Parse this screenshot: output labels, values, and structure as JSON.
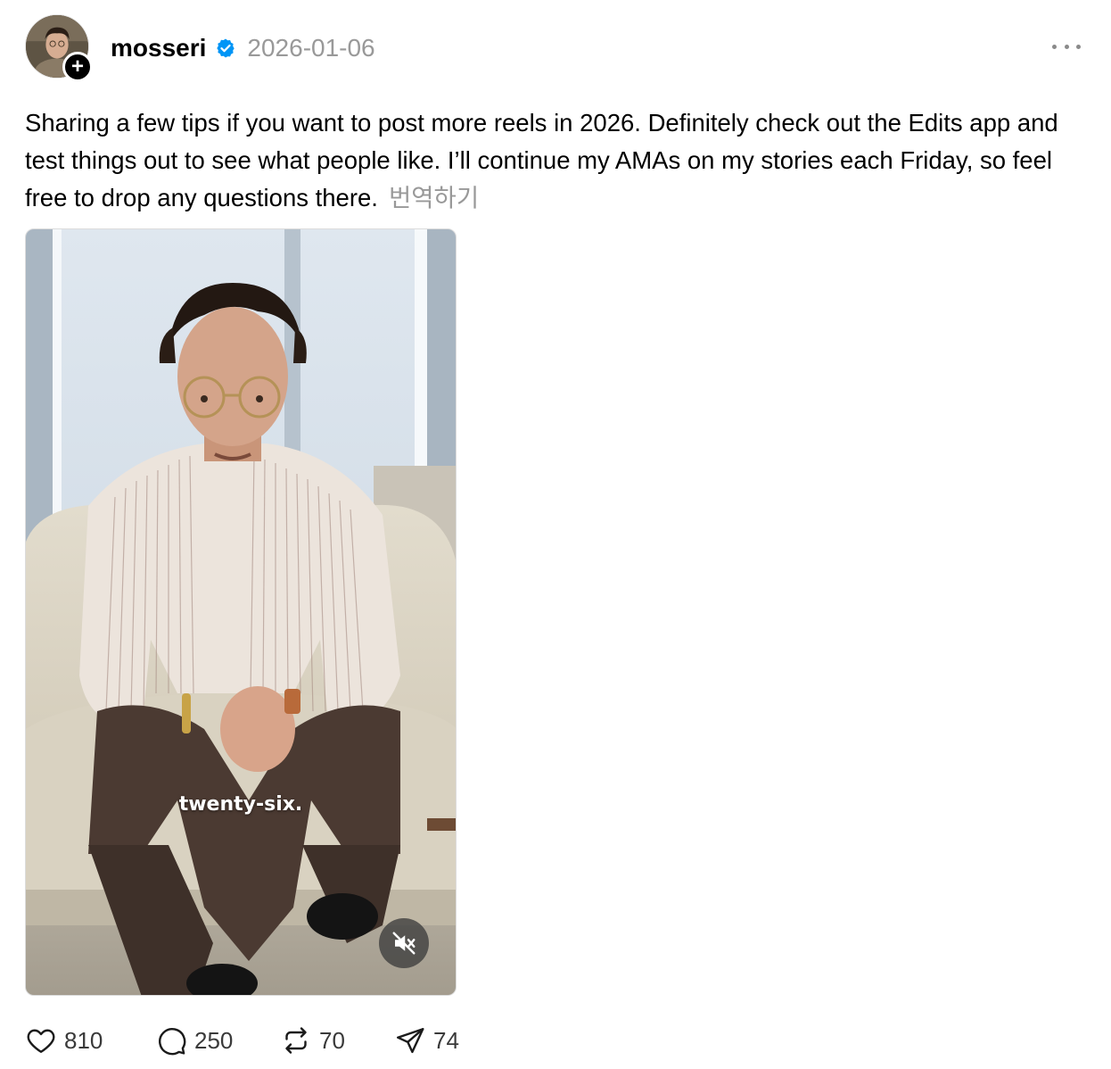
{
  "post": {
    "username": "mosseri",
    "verified_icon": "verified-badge-icon",
    "timestamp": "2026-01-06",
    "caption": "Sharing a few tips if you want to post more reels in 2026. Definitely check out the Edits app and test things out to see what people like. I’ll continue my AMAs on my stories each Friday, so feel free to drop any questions there.",
    "translate_label": "번역하기",
    "follow_symbol": "+"
  },
  "video": {
    "subtitle": "twenty-six.",
    "mute_icon": "speaker-muted-icon"
  },
  "actions": {
    "likes": "810",
    "comments": "250",
    "reposts": "70",
    "shares": "74"
  },
  "colors": {
    "verified": "#0095F6",
    "muted_text": "#999999",
    "text": "#000000"
  }
}
